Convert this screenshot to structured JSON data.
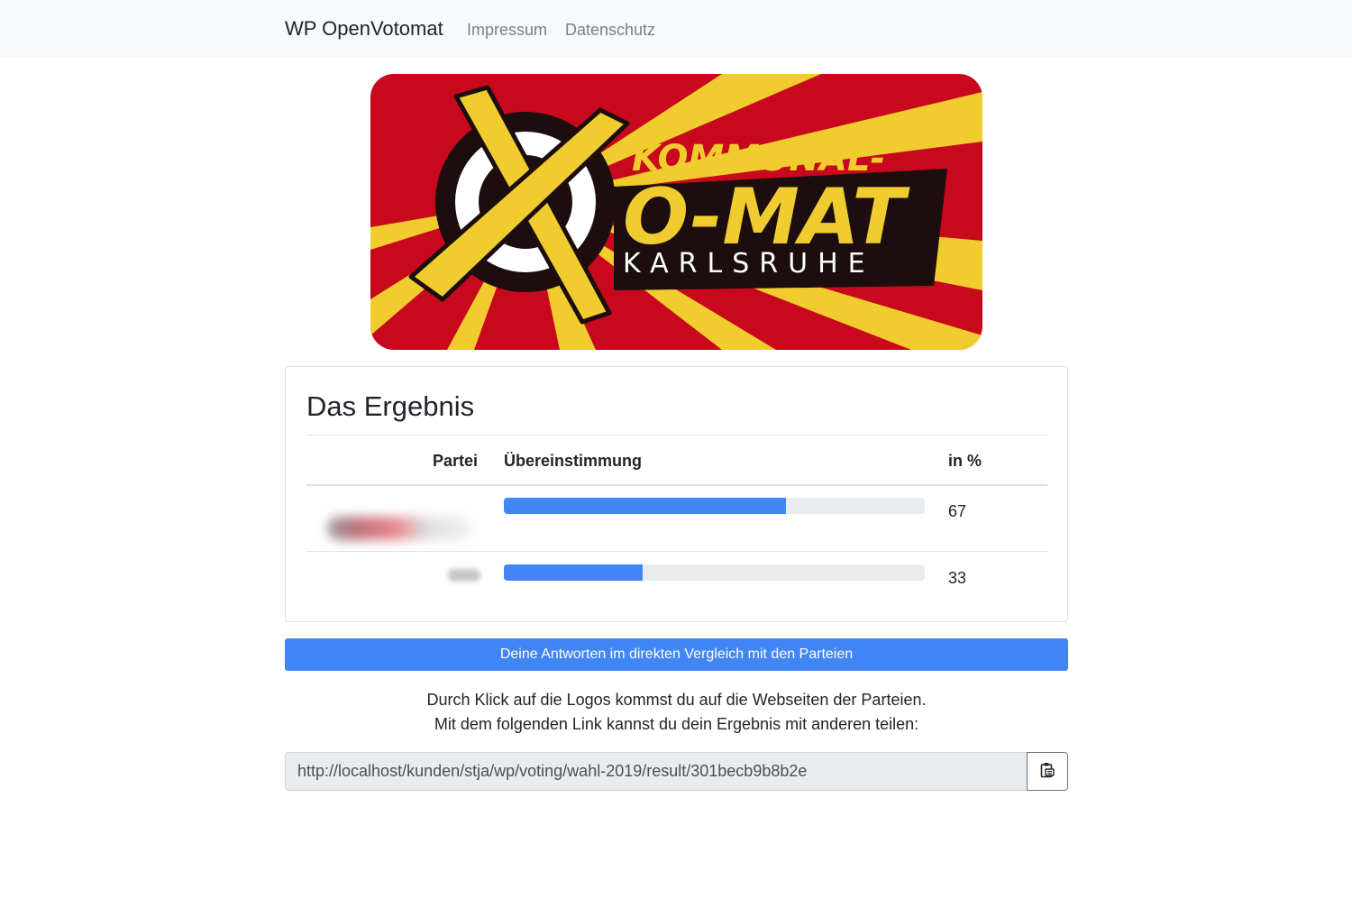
{
  "nav": {
    "brand": "WP OpenVotomat",
    "links": [
      {
        "label": "Impressum"
      },
      {
        "label": "Datenschutz"
      }
    ]
  },
  "banner": {
    "line1": "KOMMUNAL-",
    "line2": "O-MAT",
    "line3": "KARLSRUHE",
    "colors": {
      "red": "#c8081c",
      "yellow": "#f1cc2e",
      "black": "#1c0e0e",
      "white": "#ffffff"
    }
  },
  "results": {
    "title": "Das Ergebnis",
    "columns": [
      "Partei",
      "Übereinstimmung",
      "in %"
    ],
    "rows": [
      {
        "party_logo": "blurred-party-logo",
        "match_percent": 67,
        "value_label": "67"
      },
      {
        "party_logo": "blurred-party-logo",
        "match_percent": 33,
        "value_label": "33"
      }
    ],
    "bar_color": "#4285f4",
    "track_color": "#e9ecef"
  },
  "compare_button": {
    "label": "Deine Antworten im direkten Vergleich mit den Parteien"
  },
  "info": {
    "line1": "Durch Klick auf die Logos kommst du auf die Webseiten der Parteien.",
    "line2": "Mit dem folgenden Link kannst du dein Ergebnis mit anderen teilen:"
  },
  "share": {
    "url": "http://localhost/kunden/stja/wp/voting/wahl-2019/result/301becb9b8b2e",
    "copy_icon": "clipboard-icon"
  }
}
